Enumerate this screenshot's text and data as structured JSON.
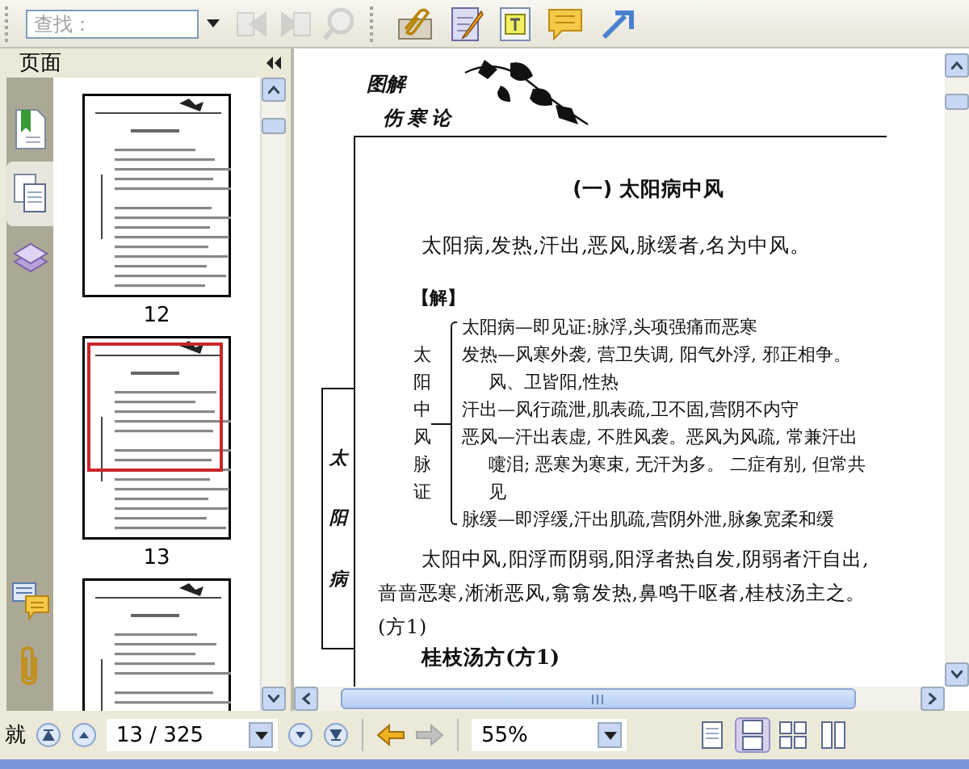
{
  "toolbar": {
    "search": {
      "placeholder": "查找："
    },
    "tools": [
      {
        "kind": "find-prev",
        "disabled": true
      },
      {
        "kind": "find-next",
        "disabled": true
      },
      {
        "kind": "search",
        "disabled": true
      }
    ],
    "tools_2": [
      {
        "kind": "attach"
      },
      {
        "kind": "note"
      },
      {
        "kind": "textbox"
      },
      {
        "kind": "comment"
      },
      {
        "kind": "arrow"
      }
    ]
  },
  "sidebar": {
    "title": "页面",
    "tabs": [
      {
        "kind": "bookmarks",
        "selected": false
      },
      {
        "kind": "pages",
        "selected": true
      },
      {
        "kind": "layers",
        "selected": false
      }
    ],
    "bottom_tabs": [
      {
        "kind": "comments"
      },
      {
        "kind": "attachments"
      }
    ],
    "thumbnails": [
      {
        "label": "12",
        "selected": false
      },
      {
        "label": "13",
        "selected": true
      },
      {
        "selected": false
      }
    ]
  },
  "document": {
    "header": [
      "图解",
      "伤寒论"
    ],
    "side_tab": "太阳病",
    "heading": "(一) 太阳病中风",
    "paragraph_1": "太阳病,发热,汗出,恶风,脉缓者,名为中风。",
    "note_label": "【解】",
    "diagram": {
      "label": "太阳中风脉证",
      "items": [
        "太阳病—即见证:脉浮,头项强痛而恶寒",
        "发热—风寒外袭, 营卫失调, 阳气外浮, 邪正相争。风、卫皆阳,性热",
        "汗出—风行疏泄,肌表疏,卫不固,营阴不内守",
        "恶风—汗出表虚, 不胜风袭。恶风为风疏, 常兼汗出嚏泪; 恶寒为寒束, 无汗为多。 二症有别, 但常共见",
        "脉缓—即浮缓,汗出肌疏,营阴外泄,脉象宽柔和缓"
      ]
    },
    "paragraph_2": "太阳中风,阳浮而阴弱,阳浮者热自发,阴弱者汗自出,啬啬恶寒,淅淅恶风,翕翕发热,鼻鸣干呕者,桂枝汤主之。(方1)",
    "formula_title": "桂枝汤方(方1)"
  },
  "status_bar": {
    "status": "就",
    "nav": [
      {
        "kind": "first",
        "disabled": false
      },
      {
        "kind": "prev",
        "disabled": false
      }
    ],
    "page": "13 / 325",
    "nav_after": [
      {
        "kind": "next",
        "disabled": false
      },
      {
        "kind": "last",
        "disabled": false
      },
      {
        "kind": "back",
        "disabled": false
      },
      {
        "kind": "forward",
        "disabled": true
      }
    ],
    "zoom": "55%",
    "view_modes": [
      {
        "kind": "single",
        "selected": false
      },
      {
        "kind": "continuous",
        "selected": true
      },
      {
        "kind": "facing",
        "selected": false
      },
      {
        "kind": "continuous-facing",
        "selected": false
      }
    ]
  }
}
